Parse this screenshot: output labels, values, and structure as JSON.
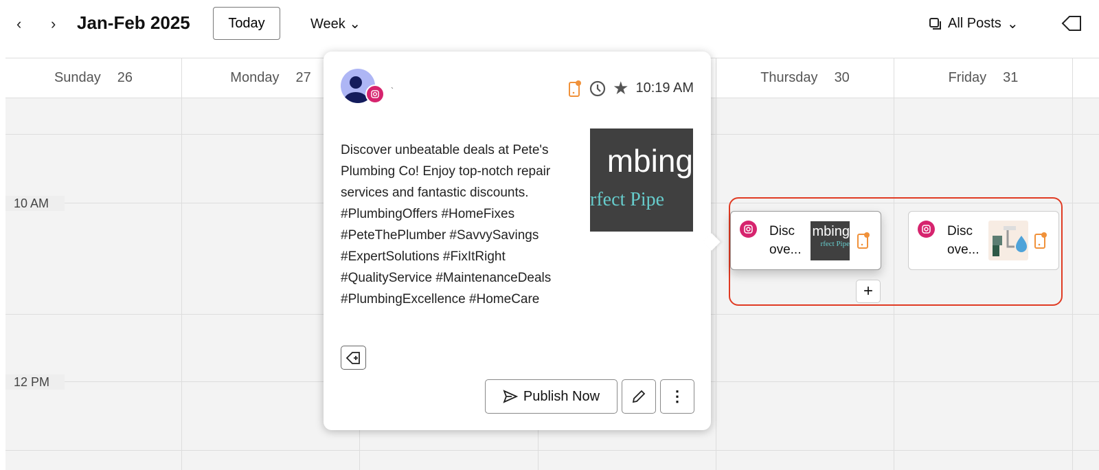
{
  "toolbar": {
    "title": "Jan-Feb 2025",
    "today": "Today",
    "view": "Week",
    "filter": "All Posts"
  },
  "days": [
    {
      "name": "Sunday",
      "num": "26"
    },
    {
      "name": "Monday",
      "num": "27"
    },
    {
      "name": "Thursday",
      "num": "30"
    },
    {
      "name": "Friday",
      "num": "31"
    }
  ],
  "times": [
    "10 AM",
    "12 PM"
  ],
  "popup": {
    "account": "`",
    "time": "10:19 AM",
    "text": "Discover unbeatable deals at Pete's Plumbing Co! Enjoy top-notch repair services and fantastic discounts. #PlumbingOffers #HomeFixes #PeteThePlumber #SavvySavings #ExpertSolutions #FixItRight #QualityService #MaintenanceDeals #PlumbingExcellence #HomeCare",
    "image_text1": "mbing",
    "image_text2": "rfect Pipe",
    "publish": "Publish Now"
  },
  "cards": [
    {
      "text": "Disc ove...",
      "day": "Thursday"
    },
    {
      "text": "Disc ove...",
      "day": "Friday"
    }
  ],
  "colors": {
    "instagram": "#d6246e",
    "mobile": "#f0913a",
    "highlight": "#e03a22"
  }
}
